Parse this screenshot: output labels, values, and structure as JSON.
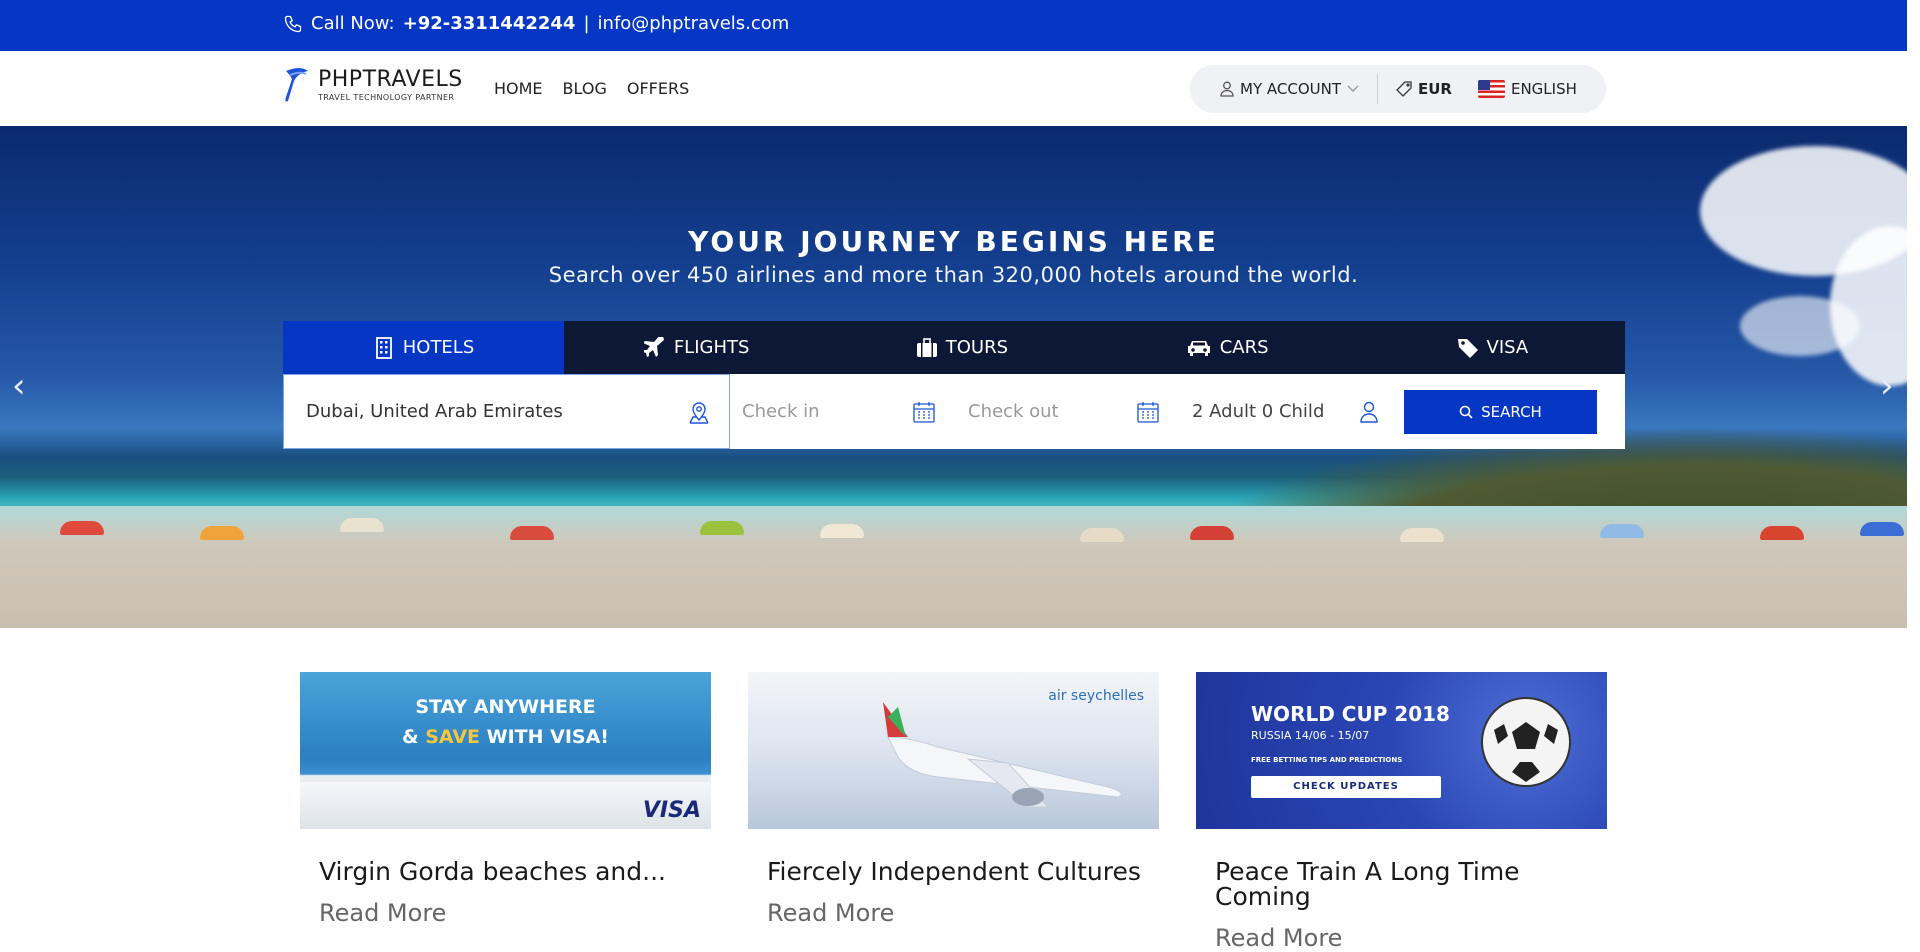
{
  "topbar": {
    "call_label": "Call Now:",
    "phone": "+92-3311442244",
    "separator": "|",
    "email": "info@phptravels.com"
  },
  "header": {
    "brand": "PHPTRAVELS",
    "tagline": "TRAVEL TECHNOLOGY PARTNER",
    "nav": [
      "HOME",
      "BLOG",
      "OFFERS"
    ],
    "account_label": "MY ACCOUNT",
    "currency": "EUR",
    "language": "ENGLISH"
  },
  "hero": {
    "title": "YOUR JOURNEY BEGINS HERE",
    "subtitle": "Search over 450 airlines and more than 320,000 hotels around the world.",
    "prev_arrow": "‹",
    "next_arrow": "›"
  },
  "search": {
    "tabs": [
      {
        "label": "HOTELS",
        "icon": "building-icon",
        "active": true
      },
      {
        "label": "FLIGHTS",
        "icon": "plane-icon",
        "active": false
      },
      {
        "label": "TOURS",
        "icon": "suitcase-icon",
        "active": false
      },
      {
        "label": "CARS",
        "icon": "car-icon",
        "active": false
      },
      {
        "label": "VISA",
        "icon": "tag-icon",
        "active": false
      }
    ],
    "destination": "Dubai, United Arab Emirates",
    "checkin_placeholder": "Check in",
    "checkout_placeholder": "Check out",
    "guests": "2 Adult 0 Child",
    "search_label": "SEARCH"
  },
  "cards": [
    {
      "title": "Virgin Gorda beaches and...",
      "more": "Read More",
      "img_line1": "STAY ANYWHERE",
      "img_line2a": "& ",
      "img_line2b": "SAVE",
      "img_line2c": " WITH VISA!",
      "img_brand": "VISA"
    },
    {
      "title": "Fiercely Independent Cultures",
      "more": "Read More",
      "img_brand": "air seychelles"
    },
    {
      "title": "Peace Train A Long Time Coming",
      "more": "Read More",
      "img_line1": "WORLD CUP 2018",
      "img_line2": "RUSSIA 14/06 - 15/07",
      "img_line3": "FREE BETTING TIPS AND PREDICTIONS",
      "img_button": "CHECK UPDATES"
    }
  ],
  "colors": {
    "brand_blue": "#0537c4",
    "tab_dark": "#0c142d"
  }
}
